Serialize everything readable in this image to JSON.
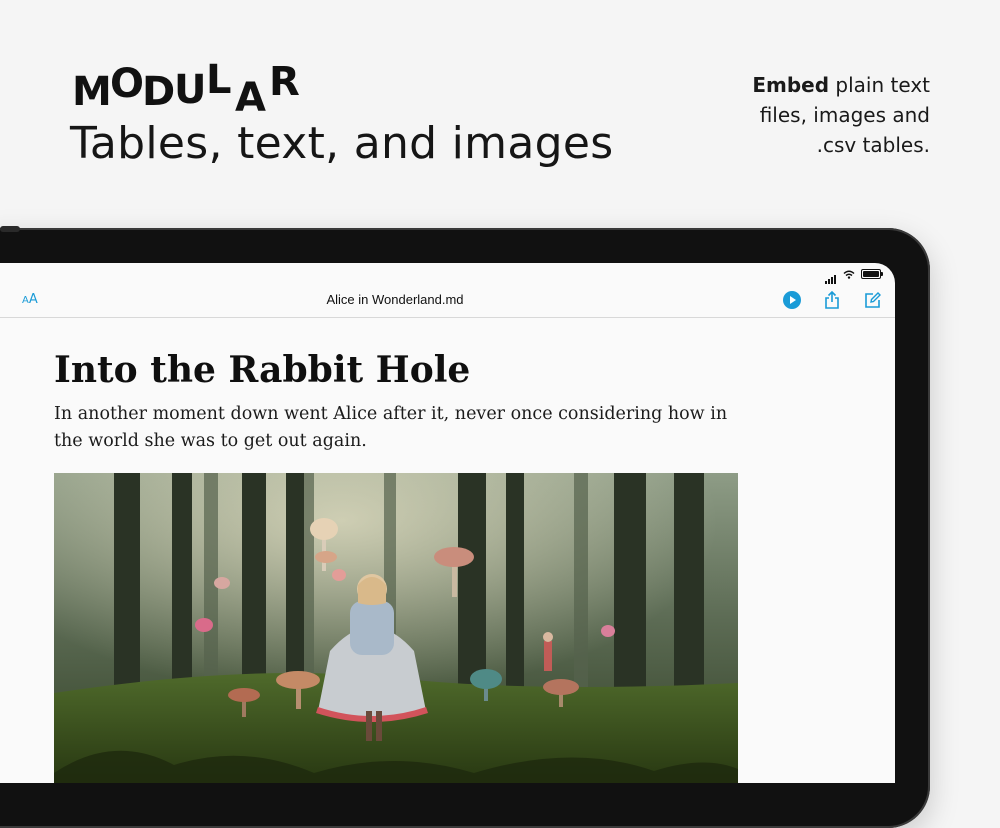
{
  "brand": {
    "logo_letters": [
      "M",
      "O",
      "D",
      "U",
      "L",
      "A",
      "R"
    ]
  },
  "headline": "Tables, text, and images",
  "tagline": {
    "bold": "Embed",
    "line1_rest": " plain text",
    "line2": "files, images and",
    "line3": ".csv tables."
  },
  "toolbar": {
    "font_button_label": "AA",
    "document_title": "Alice in Wonderland.md",
    "icons": [
      "play-icon",
      "share-icon",
      "compose-icon"
    ],
    "accent_color": "#1a9bd7"
  },
  "document": {
    "heading": "Into the Rabbit Hole",
    "paragraph": "In another moment down went Alice after it, never once considering how in the world she was to get out again.",
    "image": "Alice standing in a misty mushroom forest"
  }
}
